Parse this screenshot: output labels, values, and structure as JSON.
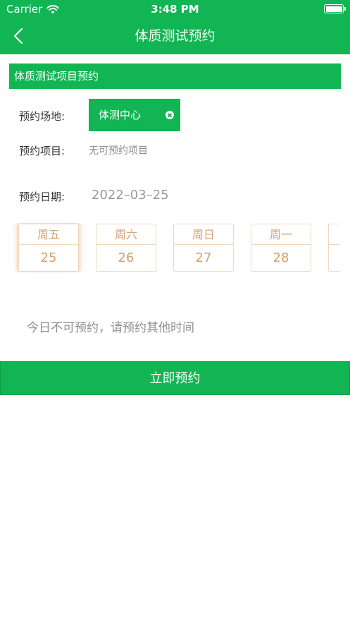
{
  "status_bar": {
    "carrier": "Carrier",
    "time": "3:48 PM"
  },
  "nav": {
    "title": "体质测试预约"
  },
  "section": {
    "title": "体质测试项目预约"
  },
  "form": {
    "venue_label": "预约场地:",
    "venue_value": "体测中心",
    "item_label": "预约项目:",
    "item_value": "无可预约项目",
    "date_label": "预约日期:",
    "date_value": "2022–03–25"
  },
  "days": [
    {
      "weekday": "周五",
      "day": "25",
      "selected": true
    },
    {
      "weekday": "周六",
      "day": "26",
      "selected": false
    },
    {
      "weekday": "周日",
      "day": "27",
      "selected": false
    },
    {
      "weekday": "周一",
      "day": "28",
      "selected": false
    },
    {
      "weekday": "",
      "day": "",
      "selected": false
    }
  ],
  "notice": "今日不可预约，请预约其他时间",
  "submit_label": "立即预约",
  "colors": {
    "primary": "#12b553",
    "day_accent": "#d4a276"
  }
}
